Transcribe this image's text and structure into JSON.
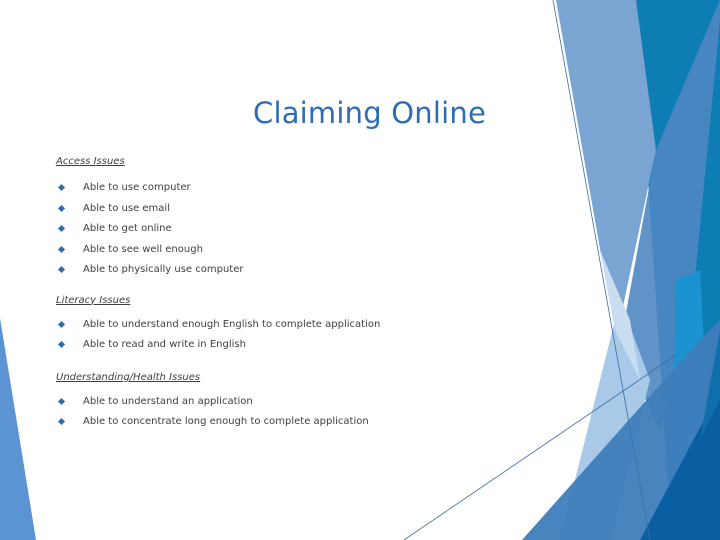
{
  "slide": {
    "title": "Claiming Online",
    "sections": [
      {
        "heading": "Access Issues",
        "items": [
          "Able to use computer",
          "Able to use email",
          "Able to get online",
          "Able to see well enough",
          "Able to physically use computer"
        ]
      },
      {
        "heading": "Literacy Issues",
        "items": [
          "Able to understand enough English to  complete application",
          "Able to read and write in English"
        ]
      },
      {
        "heading": "Understanding/Health Issues",
        "items": [
          "Able to understand an application",
          "Able to concentrate long enough to complete application"
        ]
      }
    ],
    "bullet_icon": "diamond-bullet-icon",
    "colors": {
      "title": "#2e6db4",
      "bullet": "#2e6db4",
      "text": "#404040",
      "accent_dark": "#0b7bb0",
      "accent_mid": "#4a83bf",
      "accent_light": "#a9c9e8",
      "accent_bright": "#1a93d0"
    }
  }
}
